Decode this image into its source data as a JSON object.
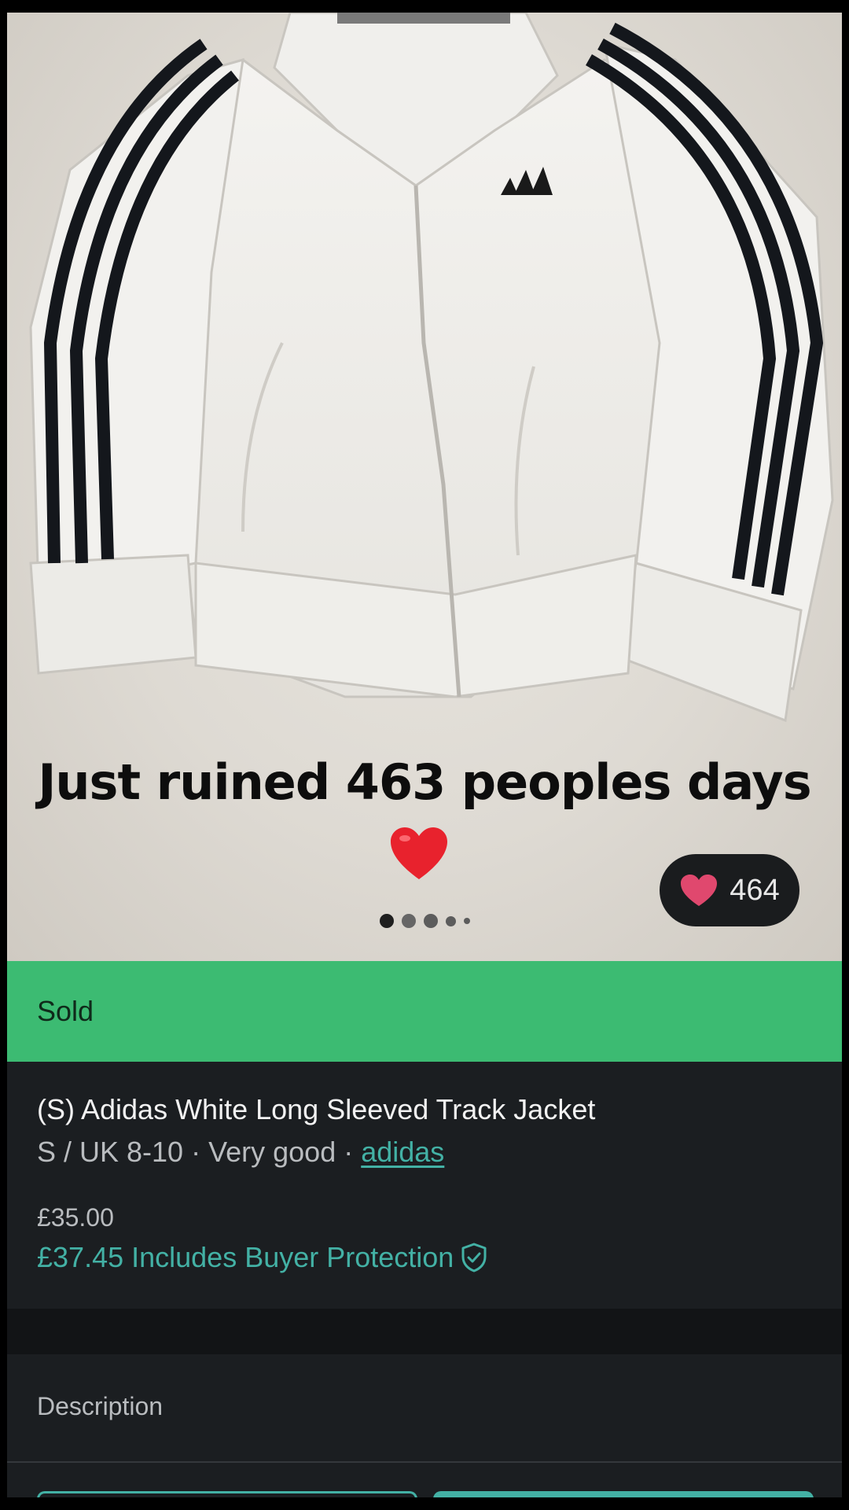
{
  "photo": {
    "overlay_caption": "Just ruined 463 peoples days",
    "caption_emoji": "heart-emoji",
    "likes_count": "464",
    "likes_icon": "heart-icon",
    "carousel_dots": 5,
    "carousel_active_index": 0
  },
  "status": {
    "label": "Sold",
    "color": "#3cbb72"
  },
  "item": {
    "title": "(S) Adidas White Long Sleeved Track Jacket",
    "size": "S / UK 8-10",
    "separator": " · ",
    "condition": "Very good",
    "brand": "adidas",
    "price": "£35.00",
    "total_price_text": "£37.45 Includes Buyer Protection",
    "protection_icon": "shield-check-icon"
  },
  "description": {
    "label": "Description"
  },
  "colors": {
    "accent": "#43b1a5",
    "background": "#1b1e21",
    "like_heart": "#e0486e"
  }
}
